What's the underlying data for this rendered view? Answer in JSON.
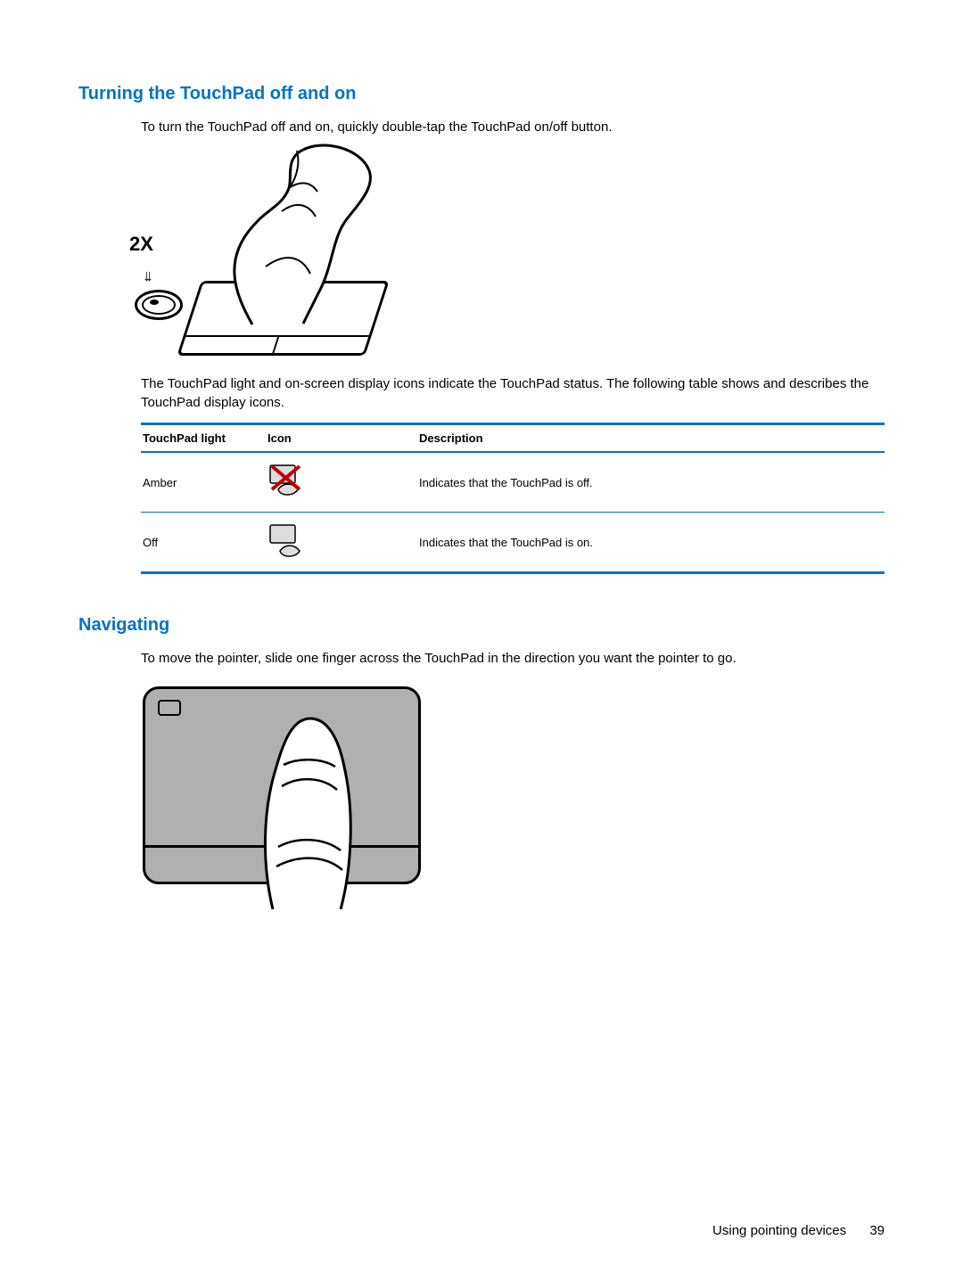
{
  "section1": {
    "heading": "Turning the TouchPad off and on",
    "intro": "To turn the TouchPad off and on, quickly double-tap the TouchPad on/off button.",
    "illustration_label": "2X",
    "after_fig": "The TouchPad light and on-screen display icons indicate the TouchPad status. The following table shows and describes the TouchPad display icons.",
    "table": {
      "headers": {
        "light": "TouchPad light",
        "icon": "Icon",
        "desc": "Description"
      },
      "rows": [
        {
          "light": "Amber",
          "icon_name": "touchpad-off-icon",
          "desc": "Indicates that the TouchPad is off."
        },
        {
          "light": "Off",
          "icon_name": "touchpad-on-icon",
          "desc": "Indicates that the TouchPad is on."
        }
      ]
    }
  },
  "section2": {
    "heading": "Navigating",
    "body": "To move the pointer, slide one finger across the TouchPad in the direction you want the pointer to go."
  },
  "footer": {
    "section": "Using pointing devices",
    "page": "39"
  }
}
